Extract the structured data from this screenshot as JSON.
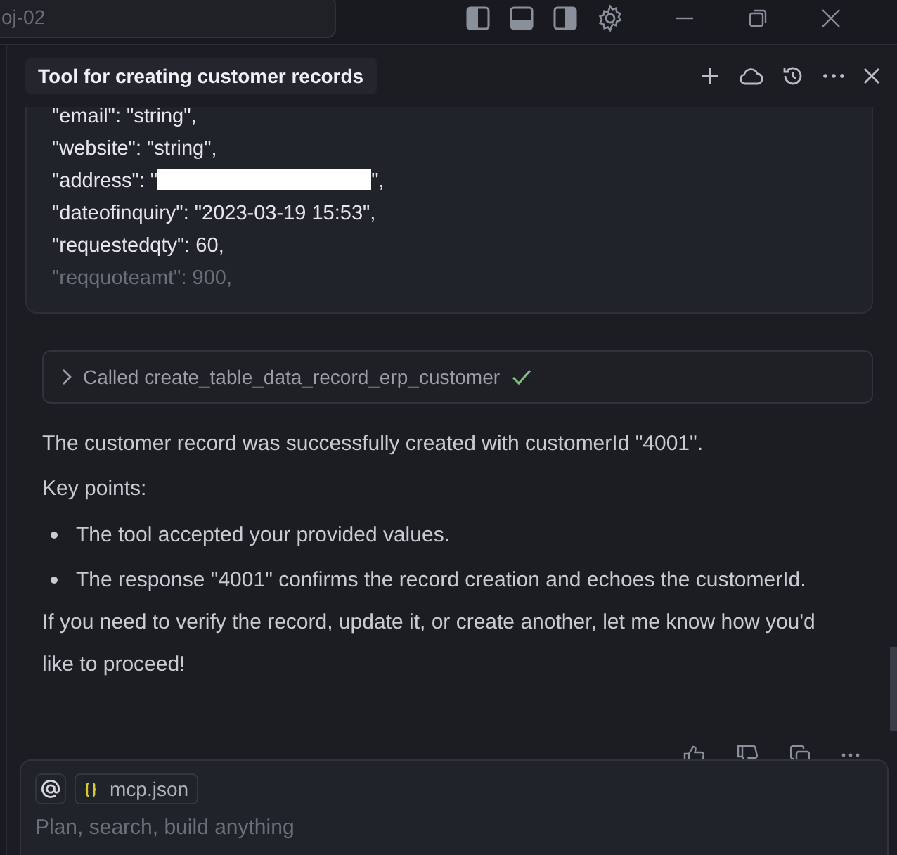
{
  "topbar": {
    "search_value": "oj-02"
  },
  "panel": {
    "title": "Tool for creating customer records"
  },
  "code_lines": [
    {
      "kind": "plain",
      "text": "\"email\": \"string\",",
      "faded": false
    },
    {
      "kind": "plain",
      "text": "\"website\": \"string\",",
      "faded": false
    },
    {
      "kind": "redacted",
      "before": "\"address\": \"",
      "after": "\",",
      "faded": false
    },
    {
      "kind": "plain",
      "text": "\"dateofinquiry\": \"2023-03-19 15:53\",",
      "faded": false
    },
    {
      "kind": "plain",
      "text": "\"requestedqty\": 60,",
      "faded": false
    },
    {
      "kind": "plain",
      "text": "\"reqquoteamt\": 900,",
      "faded": true
    }
  ],
  "tool_call": {
    "label": "Called create_table_data_record_erp_customer",
    "expanded": false,
    "done": true
  },
  "message": [
    {
      "kind": "paragraph",
      "text": "The customer record was successfully created with customerId \"4001\"."
    },
    {
      "kind": "paragraph",
      "text": "Key points:"
    },
    {
      "kind": "bullet",
      "text": "The tool accepted your provided values."
    },
    {
      "kind": "bullet",
      "text": "The response \"4001\" confirms the record creation and echoes the customerId."
    },
    {
      "kind": "paragraph",
      "text": "If you need to verify the record, update it, or create another, let me know how you'd like to proceed!"
    }
  ],
  "composer": {
    "chip": "mcp.json",
    "placeholder": "Plan, search, build anything"
  }
}
